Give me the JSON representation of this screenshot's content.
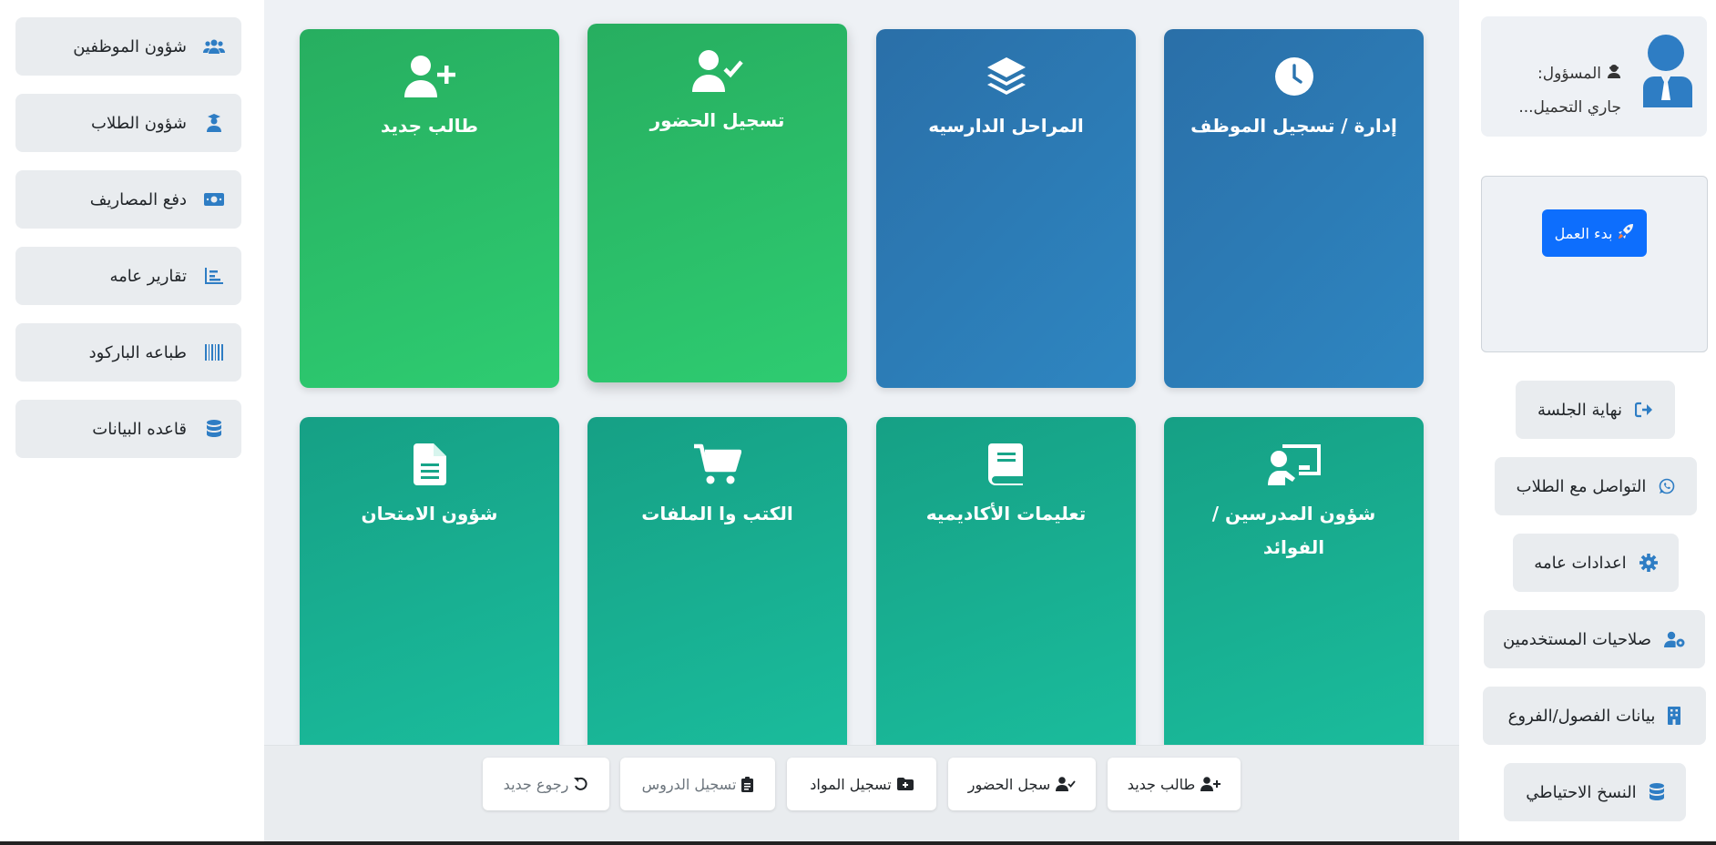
{
  "left_nav": {
    "items": [
      {
        "label": "شؤون الموظفين",
        "icon": "users-icon"
      },
      {
        "label": "شؤون الطلاب",
        "icon": "graduate-icon"
      },
      {
        "label": "دفع المصاريف",
        "icon": "money-icon"
      },
      {
        "label": "تقارير عامه",
        "icon": "chart-icon"
      },
      {
        "label": "طباعه الباركود",
        "icon": "barcode-icon"
      },
      {
        "label": "قاعده البيانات",
        "icon": "database-icon"
      }
    ]
  },
  "cards": [
    {
      "title": "إدارة / تسجيل الموظف",
      "icon": "clock-icon",
      "color": "#2e86c1"
    },
    {
      "title": "المراحل الدارسيه",
      "icon": "layers-icon",
      "color": "#2e86c1"
    },
    {
      "title": "تسجيل الحضور",
      "icon": "user-check-icon",
      "color": "#2ecc71"
    },
    {
      "title": "طالب جديد",
      "icon": "user-plus-icon",
      "color": "#2ecc71"
    },
    {
      "title": "شؤون المدرسين / الفوائد",
      "icon": "chalkboard-teacher-icon",
      "color": "#1abc9c"
    },
    {
      "title": "تعليمات الأكاديميه",
      "icon": "book-icon",
      "color": "#1abc9c"
    },
    {
      "title": "الكتب وا الملفات",
      "icon": "cart-icon",
      "color": "#1abc9c"
    },
    {
      "title": "شؤون الامتحان",
      "icon": "file-icon",
      "color": "#1abc9c"
    }
  ],
  "bottom_bar": {
    "buttons": [
      {
        "label": "طالب جديد",
        "icon": "user-plus-icon"
      },
      {
        "label": "سجل الحضور",
        "icon": "user-check-icon"
      },
      {
        "label": "تسجيل المواد",
        "icon": "folder-plus-icon"
      },
      {
        "label": "تسجيل الدروس",
        "icon": "clipboard-icon"
      },
      {
        "label": "رجوع جديد",
        "icon": "undo-icon"
      }
    ]
  },
  "profile": {
    "role_label": "المسؤول:",
    "status_text": "جاري التحميل..."
  },
  "start_button": {
    "label": "بدء العمل",
    "icon": "rocket-icon"
  },
  "right_nav": {
    "items": [
      {
        "label": "نهاية الجلسة",
        "icon": "sign-out-icon"
      },
      {
        "label": "التواصل مع الطلاب",
        "icon": "whatsapp-icon"
      },
      {
        "label": "اعدادات عامه",
        "icon": "gear-icon"
      },
      {
        "label": "صلاحيات المستخدمين",
        "icon": "user-cog-icon"
      },
      {
        "label": "بيانات الفصول/الفروع",
        "icon": "building-icon"
      },
      {
        "label": "النسخ الاحتياطي",
        "icon": "database-icon"
      }
    ]
  },
  "colors": {
    "accent_blue": "#2e86c1",
    "accent_green": "#2ecc71",
    "accent_teal": "#1abc9c",
    "primary_button": "#0d6efd",
    "icon_blue": "#2e7dc4"
  }
}
